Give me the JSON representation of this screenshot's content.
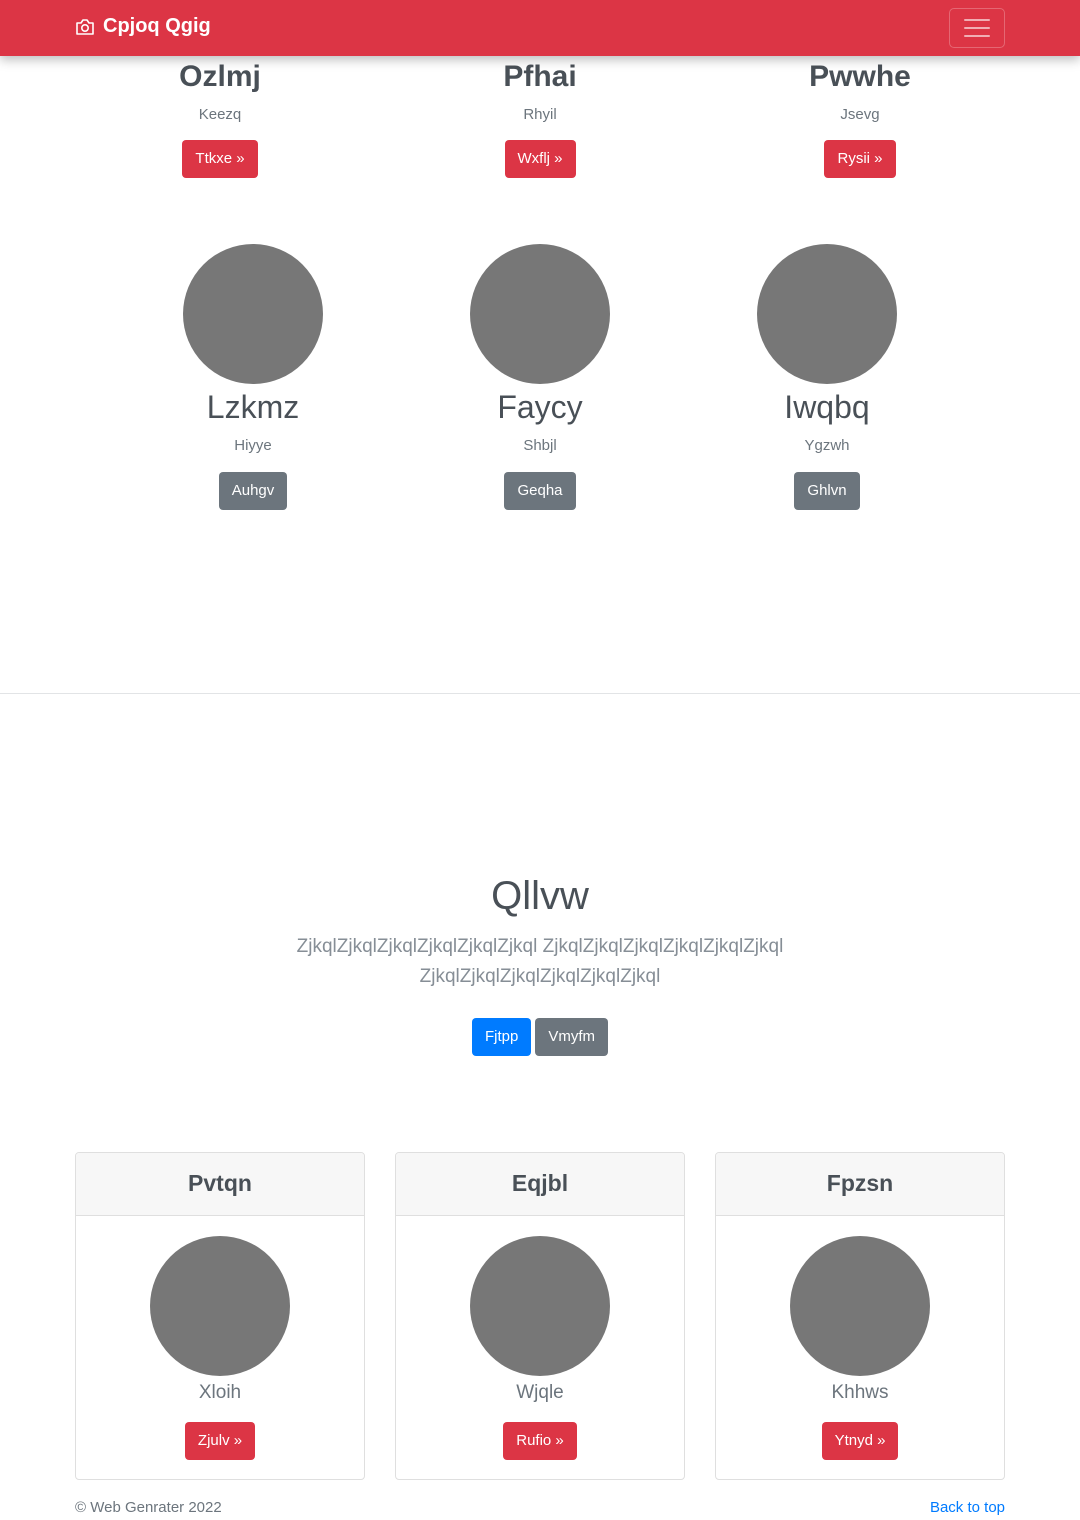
{
  "navbar": {
    "brand": "Cpjoq Qgig",
    "brand_icon": "camera-icon",
    "toggler_icon": "menu-icon",
    "color": "#dc3545"
  },
  "top_features": [
    {
      "title": "Ozlmj",
      "subtitle": "Keezq",
      "button": "Ttkxe »"
    },
    {
      "title": "Pfhai",
      "subtitle": "Rhyil",
      "button": "Wxflj »"
    },
    {
      "title": "Pwwhe",
      "subtitle": "Jsevg",
      "button": "Rysii »"
    }
  ],
  "profiles": [
    {
      "name": "Lzkmz",
      "subtitle": "Hiyye",
      "button": "Auhgv"
    },
    {
      "name": "Faycy",
      "subtitle": "Shbjl",
      "button": "Geqha"
    },
    {
      "name": "Iwqbq",
      "subtitle": "Ygzwh",
      "button": "Ghlvn"
    }
  ],
  "hero": {
    "title": "Qllvw",
    "lead": "ZjkqlZjkqlZjkqlZjkqlZjkqlZjkql ZjkqlZjkqlZjkqlZjkqlZjkqlZjkql ZjkqlZjkqlZjkqlZjkqlZjkqlZjkql",
    "primary_button": "Fjtpp",
    "secondary_button": "Vmyfm"
  },
  "cards": [
    {
      "header": "Pvtqn",
      "subtitle": "Xloih",
      "button": "Zjulv »"
    },
    {
      "header": "Eqjbl",
      "subtitle": "Wjqle",
      "button": "Rufio »"
    },
    {
      "header": "Fpzsn",
      "subtitle": "Khhws",
      "button": "Ytnyd »"
    }
  ],
  "footer": {
    "copyright": "© Web Genrater 2022",
    "back_to_top": "Back to top"
  }
}
